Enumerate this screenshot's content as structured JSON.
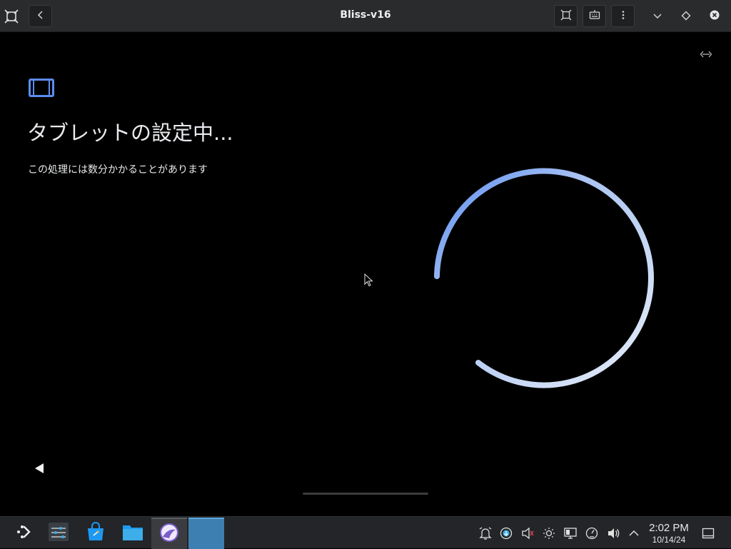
{
  "window": {
    "title": "Bliss-v16"
  },
  "titlebar": {
    "app_icon": "frame-icon",
    "back_icon": "chevron-left-icon",
    "buttons": [
      "fullscreen-icon",
      "keyboard-icon",
      "menu-dots-icon"
    ],
    "controls": [
      "minimize-icon",
      "maximize-icon",
      "close-icon"
    ]
  },
  "setup": {
    "heading": "タブレットの設定中...",
    "subtext": "この処理には数分かかることがあります",
    "accent_color": "#5b8def",
    "spinner_color": "#dfe8f8"
  },
  "taskbar": {
    "apps": [
      "launcher-icon",
      "settings-icon",
      "store-icon",
      "files-icon",
      "bliss-icon",
      "active-window-icon"
    ],
    "tray": [
      "notifications-icon",
      "update-icon",
      "mute-icon",
      "brightness-icon",
      "display-icon",
      "gauge-icon",
      "volume-icon",
      "chevron-up-icon"
    ],
    "clock": {
      "time": "2:02 PM",
      "date": "10/14/24"
    }
  }
}
